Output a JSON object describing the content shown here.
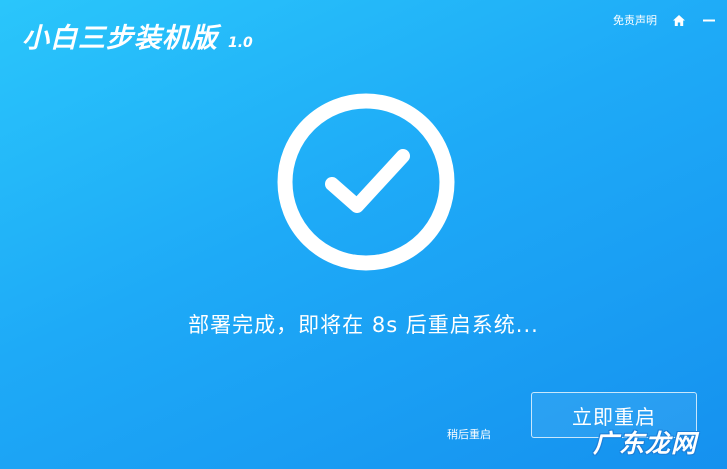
{
  "app": {
    "name": "小白三步装机版",
    "version": "1.0"
  },
  "header": {
    "disclaimer_label": "免责声明",
    "home_icon": "home-icon",
    "minimize_icon": "minimize-icon"
  },
  "status": {
    "icon": "check-circle-icon",
    "message": "部署完成，即将在 8s 后重启系统..."
  },
  "actions": {
    "later_label": "稍后重启",
    "restart_label": "立即重启"
  },
  "watermark": {
    "text": "广东龙网"
  },
  "colors": {
    "background_top": "#2ac6fb",
    "background_bottom": "#1591ef",
    "foreground": "#ffffff"
  }
}
